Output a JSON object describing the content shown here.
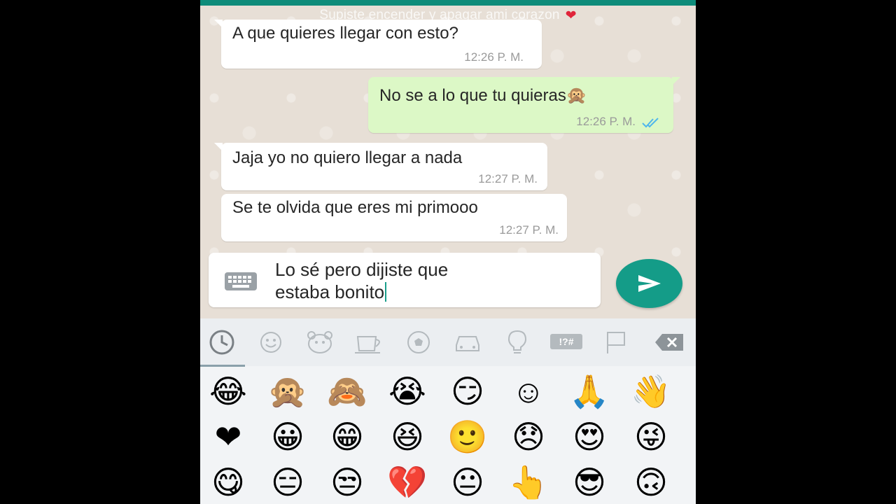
{
  "chat": {
    "title": "Supiste encender y apagar ami corazon",
    "title_emoji": "❤",
    "messages": [
      {
        "direction": "in",
        "text": "A que quieres llegar con esto?",
        "time": "12:26 P. M."
      },
      {
        "direction": "out",
        "text": "No se a lo que tu quieras",
        "emoji": "🙊",
        "time": "12:26 P. M.",
        "status": "read"
      },
      {
        "direction": "in",
        "text": "Jaja yo no quiero llegar a nada",
        "time": "12:27 P. M."
      },
      {
        "direction": "in",
        "text": "Se te olvida que eres mi primooo",
        "time": "12:27 P. M."
      }
    ]
  },
  "composer": {
    "value_line1": "Lo sé pero dijiste que",
    "value_line2": "estaba bonito"
  },
  "emoji_keyboard": {
    "categories": [
      "recent-icon",
      "smileys-icon",
      "animals-icon",
      "food-icon",
      "sports-icon",
      "travel-icon",
      "objects-icon",
      "symbols-icon",
      "flags-icon"
    ],
    "symbols_label": "!?#",
    "selected_category": "recent",
    "rows": [
      [
        "😂",
        "🙊",
        "🙈",
        "😭",
        "😏",
        "☺",
        "🙏",
        "👋"
      ],
      [
        "❤",
        "😀",
        "😁",
        "😆",
        "🙂",
        "😞",
        "😍",
        "😜"
      ],
      [
        "😋",
        "😑",
        "😒",
        "💔",
        "😐",
        "👆",
        "😎",
        "🙃"
      ]
    ]
  },
  "colors": {
    "header": "#0e8c7a",
    "outgoing_bubble": "#dcf8c6",
    "incoming_bubble": "#ffffff",
    "send_button": "#149c88",
    "read_ticks": "#4fb6ec"
  }
}
